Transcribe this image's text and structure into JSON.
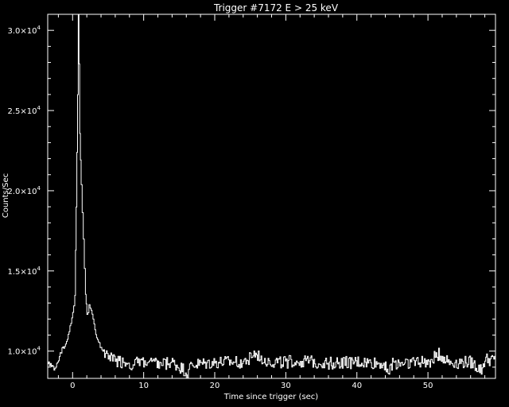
{
  "chart_data": {
    "type": "line",
    "title": "Trigger #7172  E > 25 keV",
    "xlabel": "Time since trigger (sec)",
    "ylabel": "Counts/Sec",
    "xlim": [
      -3.5,
      59.5
    ],
    "ylim": [
      8300,
      31000
    ],
    "x_ticks": [
      0,
      10,
      20,
      30,
      40,
      50
    ],
    "y_ticks": [
      {
        "value": 10000,
        "mantissa": "1.0",
        "exp": "4"
      },
      {
        "value": 15000,
        "mantissa": "1.5",
        "exp": "4"
      },
      {
        "value": 20000,
        "mantissa": "2.0",
        "exp": "4"
      },
      {
        "value": 25000,
        "mantissa": "2.5",
        "exp": "4"
      },
      {
        "value": 30000,
        "mantissa": "3.0",
        "exp": "4"
      }
    ],
    "grid": false,
    "series": [
      {
        "line_style": "histogram",
        "color": "#ffffff",
        "x": [
          -3.5,
          -2.5,
          -2.0,
          -1.5,
          -1.0,
          -0.5,
          0.0,
          0.3,
          0.5,
          0.7,
          0.8,
          0.9,
          1.0,
          1.2,
          1.5,
          1.8,
          2.0,
          2.3,
          2.6,
          3.0,
          3.5,
          4.0,
          4.5,
          5.0,
          5.5,
          6.0,
          7.0,
          8.0,
          10.0,
          12.0,
          14.0,
          16.0,
          16.3,
          16.6,
          20.0,
          24.0,
          25.5,
          28.0,
          32.0,
          36.0,
          40.0,
          44.0,
          44.5,
          45.0,
          48.0,
          50.0,
          51.5,
          53.0,
          56.0,
          57.5,
          58.0,
          59.5
        ],
        "y": [
          9300,
          8850,
          9500,
          10100,
          10400,
          11200,
          12300,
          13500,
          19000,
          26000,
          31000,
          28000,
          23500,
          20500,
          17000,
          13500,
          12200,
          12800,
          12500,
          11600,
          10700,
          10200,
          9900,
          9700,
          9500,
          9400,
          9300,
          9200,
          9300,
          9150,
          9250,
          8700,
          8600,
          9100,
          9250,
          9300,
          9800,
          9300,
          9350,
          9250,
          9300,
          9200,
          8600,
          9250,
          9350,
          9300,
          9800,
          9300,
          9300,
          8800,
          9500,
          9400
        ]
      }
    ]
  }
}
